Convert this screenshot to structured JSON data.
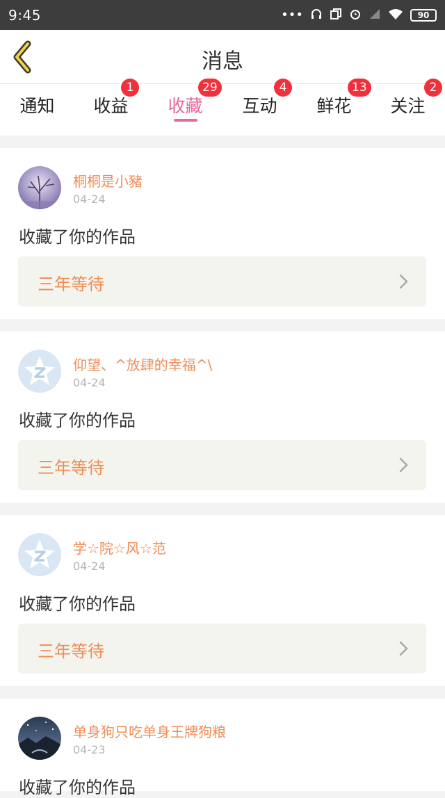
{
  "status_bar": {
    "time": "9:45",
    "battery": "90",
    "icons": [
      "more-dots-icon",
      "headphones-icon",
      "copy-icon",
      "alarm-icon",
      "signal-icon",
      "wifi-icon",
      "battery-icon"
    ]
  },
  "header": {
    "title": "消息",
    "back_icon": "chevron-left-icon"
  },
  "tabs": [
    {
      "label": "通知",
      "badge": ""
    },
    {
      "label": "收益",
      "badge": "1"
    },
    {
      "label": "收藏",
      "badge": "29",
      "active": true
    },
    {
      "label": "互动",
      "badge": "4"
    },
    {
      "label": "鲜花",
      "badge": "13"
    },
    {
      "label": "关注",
      "badge": "2"
    }
  ],
  "messages": [
    {
      "user": "桐桐是小豬",
      "date": "04-24",
      "text": "收藏了你的作品",
      "work": "三年等待",
      "avatar": "photo-purple-tree"
    },
    {
      "user": "仰望、^放肆的幸福^\\",
      "date": "04-24",
      "text": "收藏了你的作品",
      "work": "三年等待",
      "avatar": "default-qzone-star"
    },
    {
      "user": "学☆院☆风☆范",
      "date": "04-24",
      "text": "收藏了你的作品",
      "work": "三年等待",
      "avatar": "default-qzone-star"
    },
    {
      "user": "单身狗只吃单身王牌狗粮",
      "date": "04-23",
      "text": "收藏了你的作品",
      "work": "",
      "avatar": "photo-night-sky"
    }
  ],
  "colors": {
    "accent_pink": "#e9679b",
    "accent_orange": "#ef8d56",
    "badge_red": "#f0313c",
    "status_bar": "#3d3d3d",
    "work_box": "#f4f4ee"
  }
}
